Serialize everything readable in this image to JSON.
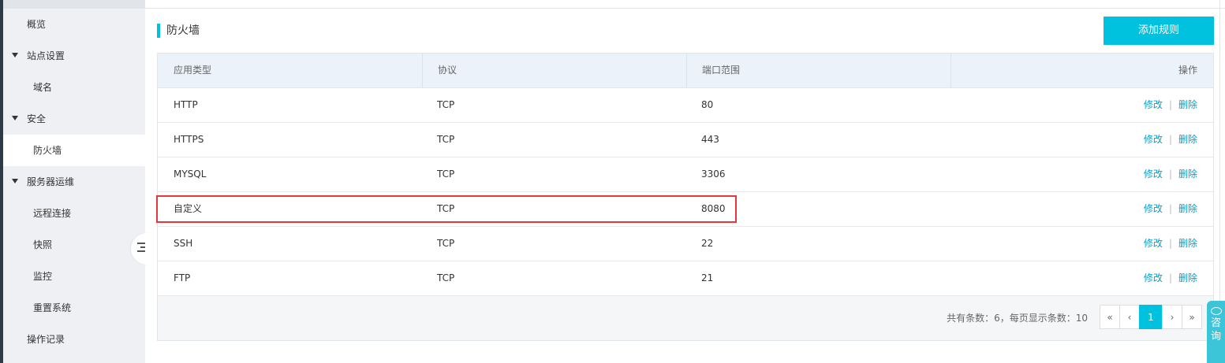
{
  "sidebar": {
    "items": [
      {
        "label": "概览",
        "level": 1,
        "expandable": false
      },
      {
        "label": "站点设置",
        "level": 1,
        "expandable": true
      },
      {
        "label": "域名",
        "level": 2
      },
      {
        "label": "安全",
        "level": 1,
        "expandable": true
      },
      {
        "label": "防火墙",
        "level": 2,
        "active": true
      },
      {
        "label": "服务器运维",
        "level": 1,
        "expandable": true
      },
      {
        "label": "远程连接",
        "level": 2
      },
      {
        "label": "快照",
        "level": 2
      },
      {
        "label": "监控",
        "level": 2
      },
      {
        "label": "重置系统",
        "level": 2
      },
      {
        "label": "操作记录",
        "level": 1,
        "expandable": false
      }
    ],
    "collapse_icon": "collapse-sidebar-icon"
  },
  "page": {
    "title": "防火墙",
    "add_button": "添加规则"
  },
  "table": {
    "headers": {
      "app_type": "应用类型",
      "protocol": "协议",
      "port_range": "端口范围",
      "actions": "操作"
    },
    "rows": [
      {
        "app_type": "HTTP",
        "protocol": "TCP",
        "port": "80"
      },
      {
        "app_type": "HTTPS",
        "protocol": "TCP",
        "port": "443"
      },
      {
        "app_type": "MYSQL",
        "protocol": "TCP",
        "port": "3306"
      },
      {
        "app_type": "自定义",
        "protocol": "TCP",
        "port": "8080"
      },
      {
        "app_type": "SSH",
        "protocol": "TCP",
        "port": "22"
      },
      {
        "app_type": "FTP",
        "protocol": "TCP",
        "port": "21"
      }
    ],
    "edit_label": "修改",
    "delete_label": "删除",
    "separator": "|"
  },
  "pagination": {
    "info": "共有条数：6，每页显示条数：10",
    "first": "«",
    "prev": "‹",
    "current": "1",
    "next": "›",
    "last": "»"
  },
  "consult": {
    "label": "咨询",
    "icon": "chat-icon"
  },
  "colors": {
    "accent": "#00c1de",
    "link": "#00a2ca",
    "highlight": "#e6383c",
    "sidebar_bg": "#eef0f3",
    "header_bg": "#ebf2f9"
  }
}
